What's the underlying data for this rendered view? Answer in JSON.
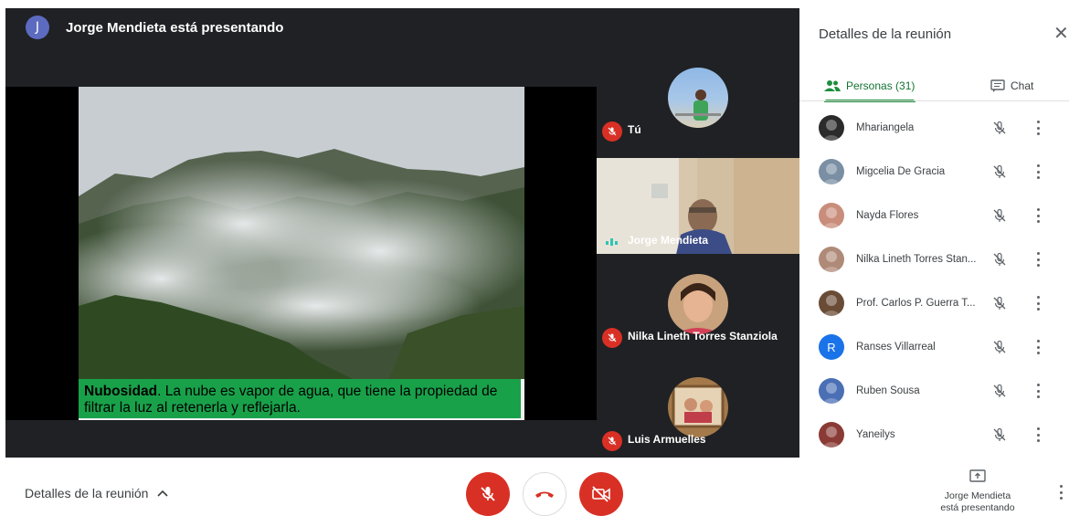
{
  "presenter_bar": {
    "avatar_initial": "J",
    "text": "Jorge Mendieta está presentando"
  },
  "slide": {
    "caption_bold": "Nubosidad",
    "caption_rest": ".  La nube es vapor de agua, que tiene la propiedad de filtrar la luz al retenerla y reflejarla."
  },
  "tiles": [
    {
      "name": "Tú",
      "muted": true
    },
    {
      "name": "Jorge Mendieta",
      "muted": false,
      "speaking": true
    },
    {
      "name": "Nilka Lineth Torres Stanziola",
      "muted": true
    },
    {
      "name": "Luis Armuelles",
      "muted": true
    }
  ],
  "panel": {
    "title": "Detalles de la reunión",
    "close_icon": "close-icon",
    "tab_people": "Personas (31)",
    "tab_chat": "Chat",
    "people": [
      {
        "name": "Mhariangela",
        "avatar_color": "#2b2b2b"
      },
      {
        "name": "Migcelia De Gracia",
        "avatar_color": "#7a8fa3"
      },
      {
        "name": "Nayda Flores",
        "avatar_color": "#c98d7b"
      },
      {
        "name": "Nilka Lineth Torres Stan...",
        "avatar_color": "#b08a78"
      },
      {
        "name": "Prof. Carlos P. Guerra T...",
        "avatar_color": "#6a4c36"
      },
      {
        "name": "Ranses Villarreal",
        "avatar_color": "#1a73e8",
        "initial": "R"
      },
      {
        "name": "Ruben Sousa",
        "avatar_color": "#4a6fb5"
      },
      {
        "name": "Yaneilys",
        "avatar_color": "#8a3b35"
      }
    ]
  },
  "bottom": {
    "details_label": "Detalles de la reunión",
    "presenting_line1": "Jorge Mendieta",
    "presenting_line2": "está presentando"
  },
  "colors": {
    "danger": "#d93025",
    "accent_green": "#1e8e3e",
    "stage_bg": "#202124"
  }
}
